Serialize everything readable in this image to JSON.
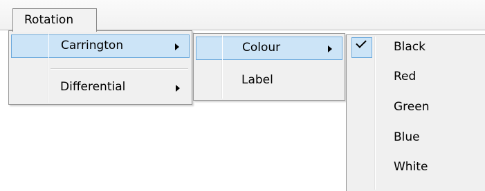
{
  "menubar": {
    "rotation_label": "Rotation"
  },
  "rotation_menu": {
    "items": [
      {
        "label": "Carrington",
        "has_submenu": true,
        "highlighted": true
      },
      {
        "label": "Differential",
        "has_submenu": true,
        "highlighted": false
      }
    ]
  },
  "carrington_menu": {
    "items": [
      {
        "label": "Colour",
        "has_submenu": true,
        "highlighted": true
      },
      {
        "label": "Label",
        "has_submenu": false,
        "highlighted": false
      }
    ]
  },
  "colour_menu": {
    "checked": "Black",
    "items": [
      {
        "label": "Black"
      },
      {
        "label": "Red"
      },
      {
        "label": "Green"
      },
      {
        "label": "Blue"
      },
      {
        "label": "White"
      }
    ]
  },
  "colors": {
    "highlight_fill": "#cce4f7",
    "highlight_border": "#6aa8dc",
    "menu_background": "#f0f0f0"
  }
}
